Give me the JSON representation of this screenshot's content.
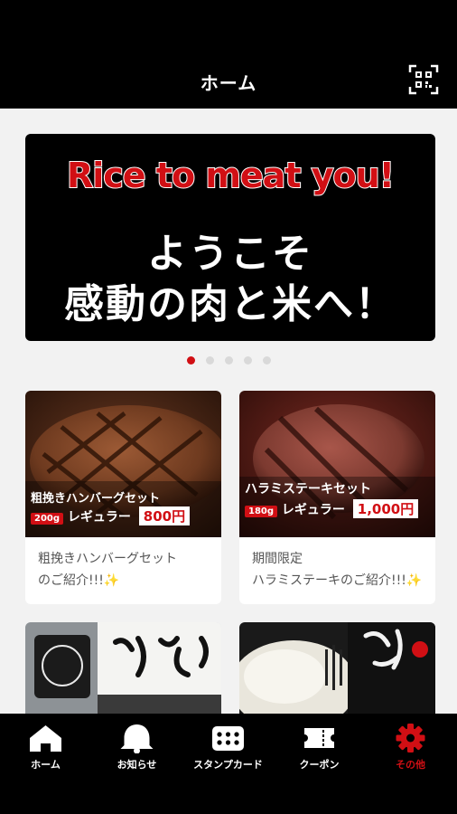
{
  "header": {
    "title": "ホーム"
  },
  "banner": {
    "english": "Rice to meat you!",
    "line1": "ようこそ",
    "line2": "感動の肉と米へ！"
  },
  "carousel": {
    "total": 5,
    "active_index": 0
  },
  "cards": [
    {
      "image_title": "粗挽きハンバーグセット",
      "image_weight": "200g",
      "image_size": "レギュラー",
      "image_price": "800円",
      "caption_lines": [
        "粗挽きハンバーグセット",
        "のご紹介!!!✨"
      ]
    },
    {
      "image_title": "ハラミステーキセット",
      "image_weight": "180g",
      "image_size": "レギュラー",
      "image_price": "1,000円",
      "caption_lines": [
        "期間限定",
        "ハラミステーキのご紹介!!!✨"
      ]
    }
  ],
  "nav": {
    "items": [
      {
        "label": "ホーム",
        "icon": "home-icon"
      },
      {
        "label": "お知らせ",
        "icon": "bell-icon"
      },
      {
        "label": "スタンプカード",
        "icon": "stamp-card-icon"
      },
      {
        "label": "クーポン",
        "icon": "coupon-icon"
      },
      {
        "label": "その他",
        "icon": "gear-icon"
      }
    ],
    "active": "その他"
  },
  "colors": {
    "accent": "#d10f14",
    "bar": "#000000",
    "background": "#f2f2f2"
  }
}
